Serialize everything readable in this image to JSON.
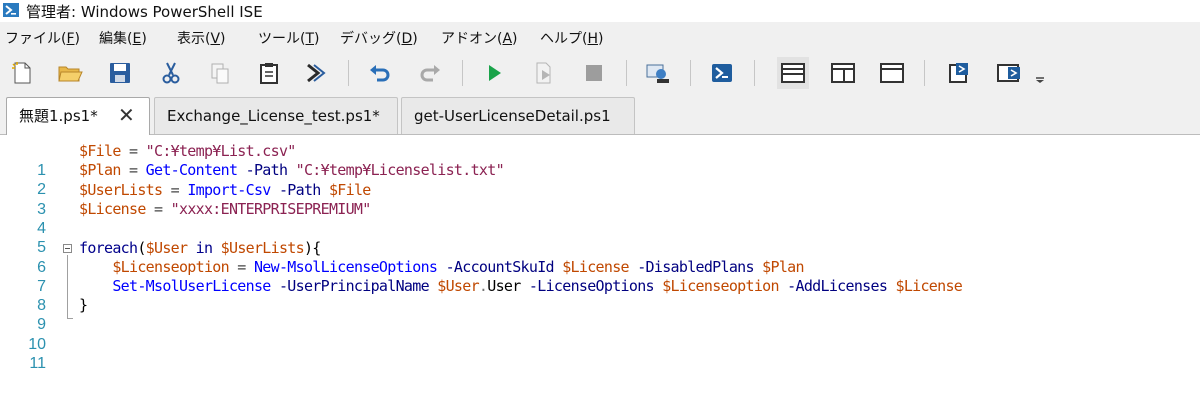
{
  "window": {
    "title": "管理者: Windows PowerShell ISE"
  },
  "menu": [
    {
      "label": "ファイル(",
      "mnemonic": "F",
      "suffix": ")"
    },
    {
      "label": "編集(",
      "mnemonic": "E",
      "suffix": ")"
    },
    {
      "label": "表示(",
      "mnemonic": "V",
      "suffix": ")"
    },
    {
      "label": "ツール(",
      "mnemonic": "T",
      "suffix": ")"
    },
    {
      "label": "デバッグ(",
      "mnemonic": "D",
      "suffix": ")"
    },
    {
      "label": "アドオン(",
      "mnemonic": "A",
      "suffix": ")"
    },
    {
      "label": "ヘルプ(",
      "mnemonic": "H",
      "suffix": ")"
    }
  ],
  "toolbar": {
    "icons": [
      "new-file-icon",
      "open-folder-icon",
      "save-icon",
      "cut-icon",
      "copy-icon",
      "paste-icon",
      "console-icon",
      "undo-icon",
      "redo-icon",
      "run-icon",
      "run-selection-icon",
      "stop-icon",
      "remote-powershell-icon",
      "powershell-icon",
      "script-pane-top-icon",
      "script-pane-right-icon",
      "script-pane-maximized-icon",
      "show-script-pane-icon",
      "command-addon-icon",
      "toolbar-overflow-icon"
    ],
    "colors": {
      "run": "#1aa34a",
      "undo": "#2a6fb8",
      "powershell": "#1f5d9e"
    }
  },
  "tabs": [
    {
      "label": "無題1.ps1*",
      "active": true,
      "close": "✕"
    },
    {
      "label": "Exchange_License_test.ps1*",
      "active": false
    },
    {
      "label": "get-UserLicenseDetail.ps1",
      "active": false
    }
  ],
  "editor": {
    "line_numbers": [
      "1",
      "2",
      "3",
      "4",
      "5",
      "6",
      "7",
      "8",
      "9",
      "10",
      "11"
    ],
    "tokens": {
      "l1_var": "$File",
      "l1_eq": " = ",
      "l1_str": "\"C:¥temp¥List.csv\"",
      "l2_var": "$Plan",
      "l2_eq": " = ",
      "l2_cmd": "Get-Content",
      "l2_param": " -Path ",
      "l2_str": "\"C:¥temp¥Licenselist.txt\"",
      "l3_var": "$UserLists",
      "l3_eq": " = ",
      "l3_cmd": "Import-Csv",
      "l3_param": " -Path ",
      "l3_var2": "$File",
      "l4_var": "$License",
      "l4_eq": " = ",
      "l4_str": "\"xxxx:ENTERPRISEPREMIUM\"",
      "l6_kw": "foreach",
      "l6_open": "(",
      "l6_var": "$User",
      "l6_in": " in ",
      "l6_var2": "$UserLists",
      "l6_close": "){",
      "l7_indent": "    ",
      "l7_var": "$Licenseoption",
      "l7_eq": " = ",
      "l7_cmd": "New-MsolLicenseOptions",
      "l7_p1": " -AccountSkuId ",
      "l7_v1": "$License",
      "l7_p2": " -DisabledPlans ",
      "l7_v2": "$Plan",
      "l8_indent": "    ",
      "l8_cmd": "Set-MsolUserLicense",
      "l8_p1": " -UserPrincipalName ",
      "l8_v1": "$User",
      "l8_dot": ".",
      "l8_member": "User",
      "l8_p2": " -LicenseOptions ",
      "l8_v2": "$Licenseoption",
      "l8_p3": " -AddLicenses ",
      "l8_v3": "$License",
      "l9_close": "}"
    }
  }
}
